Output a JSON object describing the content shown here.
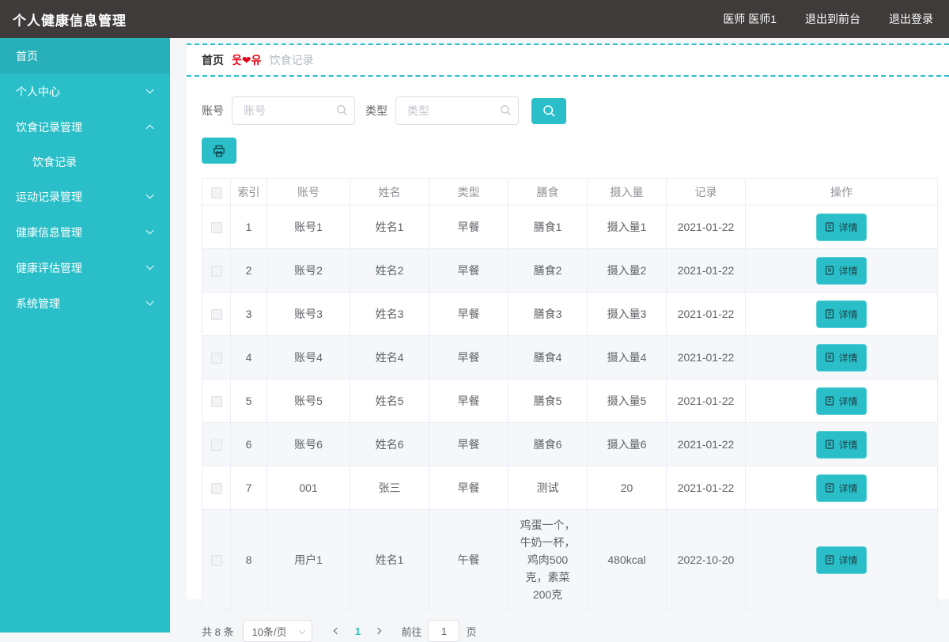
{
  "header": {
    "title": "个人健康信息管理",
    "user": "医师 医师1",
    "exit_front": "退出到前台",
    "logout": "退出登录"
  },
  "sidebar": {
    "items": [
      {
        "label": "首页",
        "expandable": false,
        "active": true
      },
      {
        "label": "个人中心",
        "expandable": true,
        "expanded": false
      },
      {
        "label": "饮食记录管理",
        "expandable": true,
        "expanded": true,
        "children": [
          {
            "label": "饮食记录"
          }
        ]
      },
      {
        "label": "运动记录管理",
        "expandable": true,
        "expanded": false
      },
      {
        "label": "健康信息管理",
        "expandable": true,
        "expanded": false
      },
      {
        "label": "健康评估管理",
        "expandable": true,
        "expanded": false
      },
      {
        "label": "系统管理",
        "expandable": true,
        "expanded": false
      }
    ]
  },
  "breadcrumb": {
    "home": "首页",
    "separator": "웃❤유",
    "current": "饮食记录"
  },
  "filters": {
    "account_label": "账号",
    "account_placeholder": "账号",
    "account_value": "",
    "type_label": "类型",
    "type_placeholder": "类型",
    "type_value": "",
    "search_icon": "magnifier-icon",
    "print_icon": "printer-icon"
  },
  "table": {
    "columns": [
      "索引",
      "账号",
      "姓名",
      "类型",
      "膳食",
      "摄入量",
      "记录",
      "操作"
    ],
    "detail_label": "详情",
    "rows": [
      {
        "index": "1",
        "account": "账号1",
        "name": "姓名1",
        "type": "早餐",
        "meal": "膳食1",
        "intake": "摄入量1",
        "record": "2021-01-22"
      },
      {
        "index": "2",
        "account": "账号2",
        "name": "姓名2",
        "type": "早餐",
        "meal": "膳食2",
        "intake": "摄入量2",
        "record": "2021-01-22"
      },
      {
        "index": "3",
        "account": "账号3",
        "name": "姓名3",
        "type": "早餐",
        "meal": "膳食3",
        "intake": "摄入量3",
        "record": "2021-01-22"
      },
      {
        "index": "4",
        "account": "账号4",
        "name": "姓名4",
        "type": "早餐",
        "meal": "膳食4",
        "intake": "摄入量4",
        "record": "2021-01-22"
      },
      {
        "index": "5",
        "account": "账号5",
        "name": "姓名5",
        "type": "早餐",
        "meal": "膳食5",
        "intake": "摄入量5",
        "record": "2021-01-22"
      },
      {
        "index": "6",
        "account": "账号6",
        "name": "姓名6",
        "type": "早餐",
        "meal": "膳食6",
        "intake": "摄入量6",
        "record": "2021-01-22"
      },
      {
        "index": "7",
        "account": "001",
        "name": "张三",
        "type": "早餐",
        "meal": "测试",
        "intake": "20",
        "record": "2021-01-22"
      },
      {
        "index": "8",
        "account": "用户1",
        "name": "姓名1",
        "type": "午餐",
        "meal": "鸡蛋一个，牛奶一杯，鸡肉500克，素菜200克",
        "intake": "480kcal",
        "record": "2022-10-20"
      }
    ]
  },
  "pagination": {
    "total": "共 8 条",
    "page_size": "10条/页",
    "current_page": "1",
    "goto_label": "前往",
    "goto_value": "1",
    "page_label": "页"
  },
  "colors": {
    "accent": "#2abfc8",
    "header_bg": "#3e3b3a",
    "separator_red": "#e60012"
  }
}
